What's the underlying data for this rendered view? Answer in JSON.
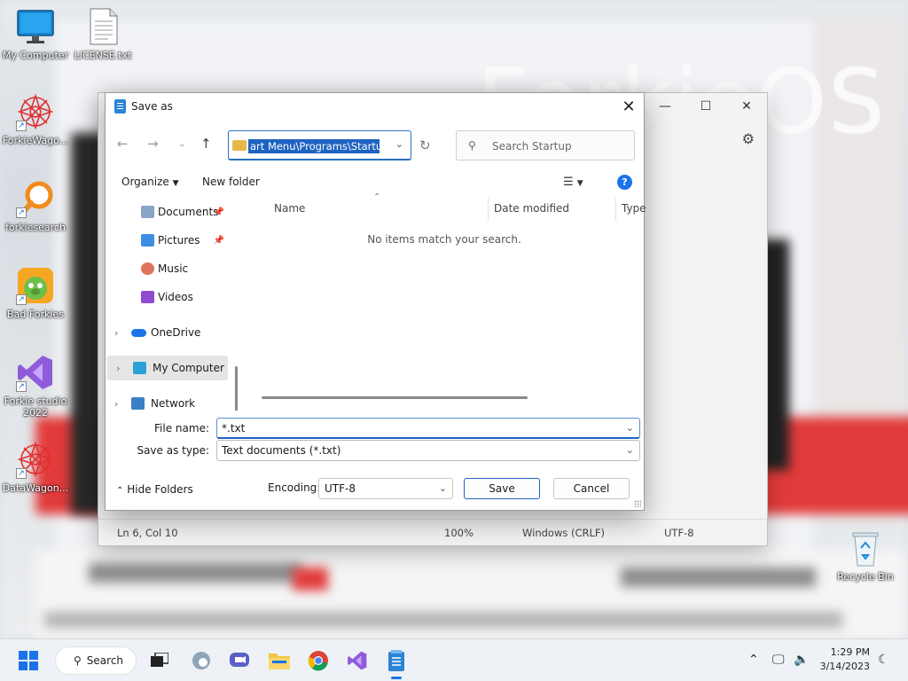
{
  "wallpaper": {
    "brand_text": "ForkieOS"
  },
  "desktop": {
    "icons": [
      {
        "label": "My Computer",
        "icon": "monitor-icon"
      },
      {
        "label": "LICENSE.txt",
        "icon": "text-file-icon"
      },
      {
        "label": "ForkieWago...",
        "icon": "wagon-logo-icon"
      },
      {
        "label": "forkiesearch",
        "icon": "magnifier-icon"
      },
      {
        "label": "Bad Forkies",
        "icon": "game-icon"
      },
      {
        "label": "Forkie studio 2022",
        "icon": "studio-icon"
      },
      {
        "label": "DataWagon...",
        "icon": "wagon-logo-icon"
      }
    ],
    "recycle_bin": "Recycle Bin"
  },
  "notepad": {
    "status": {
      "position": "Ln 6, Col 10",
      "zoom": "100%",
      "line_ending": "Windows (CRLF)",
      "encoding": "UTF-8"
    }
  },
  "dialog": {
    "title": "Save as",
    "address_path": "art Menu\\Programs\\Startup",
    "search_placeholder": "Search Startup",
    "toolbar": {
      "organize": "Organize",
      "new_folder": "New folder"
    },
    "nav": {
      "items": [
        {
          "label": "Documents",
          "pinned": true
        },
        {
          "label": "Pictures",
          "pinned": true
        },
        {
          "label": "Music",
          "pinned": false
        },
        {
          "label": "Videos",
          "pinned": false
        },
        {
          "label": "OneDrive",
          "expandable": true
        },
        {
          "label": "My Computer",
          "expandable": true,
          "selected": true
        },
        {
          "label": "Network",
          "expandable": true
        }
      ]
    },
    "columns": {
      "name": "Name",
      "date_modified": "Date modified",
      "type": "Type"
    },
    "empty_message": "No items match your search.",
    "file_name_label": "File name:",
    "file_name_value": "*.txt",
    "save_as_type_label": "Save as type:",
    "save_as_type_value": "Text documents (*.txt)",
    "hide_folders": "Hide Folders",
    "encoding_label": "Encoding:",
    "encoding_value": "UTF-8",
    "save_button": "Save",
    "cancel_button": "Cancel"
  },
  "taskbar": {
    "search_label": "Search",
    "time": "1:29 PM",
    "date": "3/14/2023"
  },
  "colors": {
    "accent": "#1e63c2",
    "brand_red": "#e23b3b"
  }
}
